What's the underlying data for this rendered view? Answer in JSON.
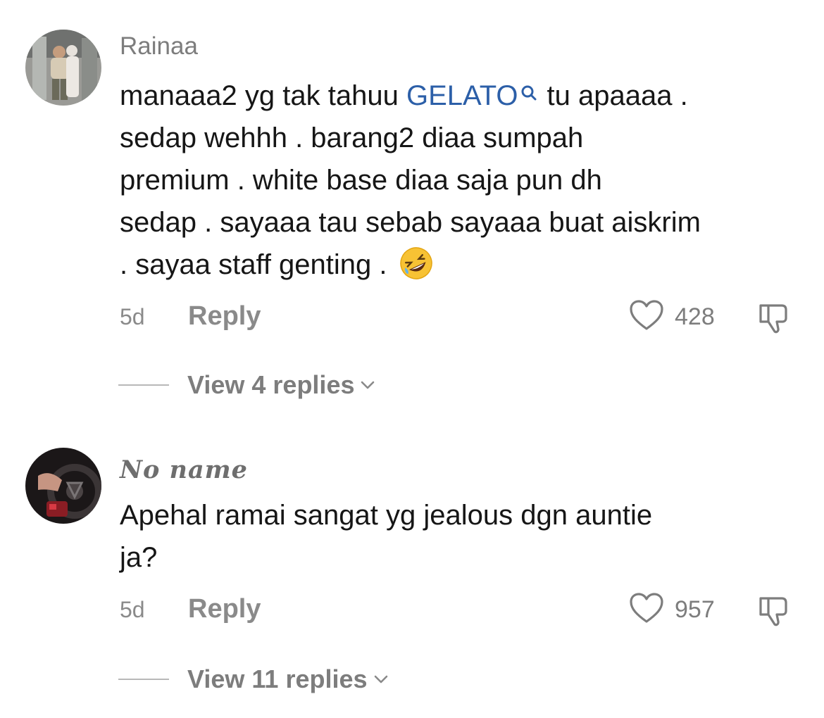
{
  "comments": [
    {
      "username": "Rainaa",
      "text_before_link": "manaaa2 yg tak tahuu ",
      "link_text": "GELATO",
      "text_after_link": "tu apaaaa .",
      "lines": [
        "sedap wehhh . barang2 diaa sumpah",
        "premium . white base diaa saja pun dh",
        "sedap . sayaaa tau sebab sayaaa buat aiskrim",
        ". sayaa staff genting ."
      ],
      "emoji_icon": "rolling-on-floor-laughing-emoji",
      "time": "5d",
      "reply_label": "Reply",
      "like_count": "428",
      "view_replies_label": "View 4 replies"
    },
    {
      "username": "𝓝𝓸 𝓷𝓪𝓶𝓮",
      "username_display": "No name",
      "lines": [
        "Apehal ramai sangat yg jealous dgn auntie",
        "ja?"
      ],
      "time": "5d",
      "reply_label": "Reply",
      "like_count": "957",
      "view_replies_label": "View 11 replies"
    }
  ],
  "colors": {
    "link": "#2c5fa8",
    "muted": "#8a8a8a",
    "text": "#161616"
  }
}
